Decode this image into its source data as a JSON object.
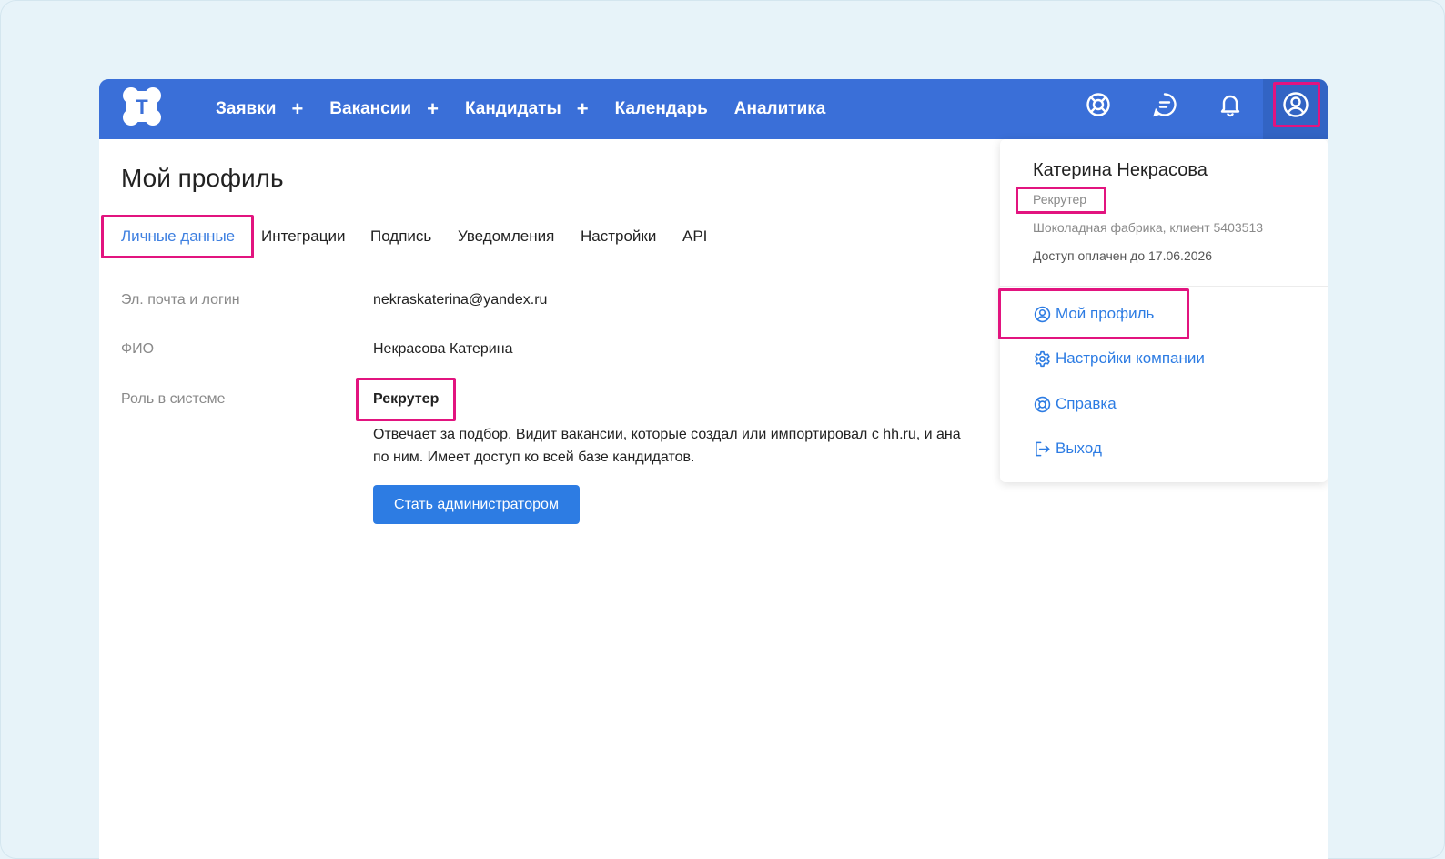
{
  "nav": {
    "items": [
      {
        "label": "Заявки",
        "plus": "+"
      },
      {
        "label": "Вакансии",
        "plus": "+"
      },
      {
        "label": "Кандидаты",
        "plus": "+"
      },
      {
        "label": "Календарь"
      },
      {
        "label": "Аналитика"
      }
    ],
    "logo_letter": "T",
    "icons": [
      "lifebuoy-icon",
      "chat-icon",
      "bell-icon",
      "user-circle-icon"
    ]
  },
  "page": {
    "title": "Мой профиль",
    "tabs": [
      "Личные данные",
      "Интеграции",
      "Подпись",
      "Уведомления",
      "Настройки",
      "API"
    ],
    "active_tab": "Личные данные"
  },
  "fields": {
    "email_label": "Эл. почта и логин",
    "email_value": "nekraskaterina@yandex.ru",
    "name_label": "ФИО",
    "name_value": "Некрасова Катерина",
    "role_label": "Роль в системе",
    "role_value": "Рекрутер",
    "role_desc_line1": "Отвечает за подбор. Видит вакансии, которые создал или импортировал с hh.ru, и ана",
    "role_desc_line2": "по ним. Имеет доступ ко всей базе кандидатов.",
    "admin_button": "Стать администратором"
  },
  "dropdown": {
    "name": "Катерина Некрасова",
    "role": "Рекрутер",
    "company": "Шоколадная фабрика, клиент 5403513",
    "access": "Доступ оплачен до 17.06.2026",
    "items": [
      {
        "label": "Мой профиль",
        "icon": "user-circle-icon"
      },
      {
        "label": "Настройки компании",
        "icon": "gear-icon"
      },
      {
        "label": "Справка",
        "icon": "lifebuoy-icon"
      },
      {
        "label": "Выход",
        "icon": "logout-icon"
      }
    ]
  },
  "colors": {
    "header": "#3a6fd8",
    "accent": "#2d7ce3",
    "highlight": "#e2147f",
    "background": "#e7f3f9"
  }
}
